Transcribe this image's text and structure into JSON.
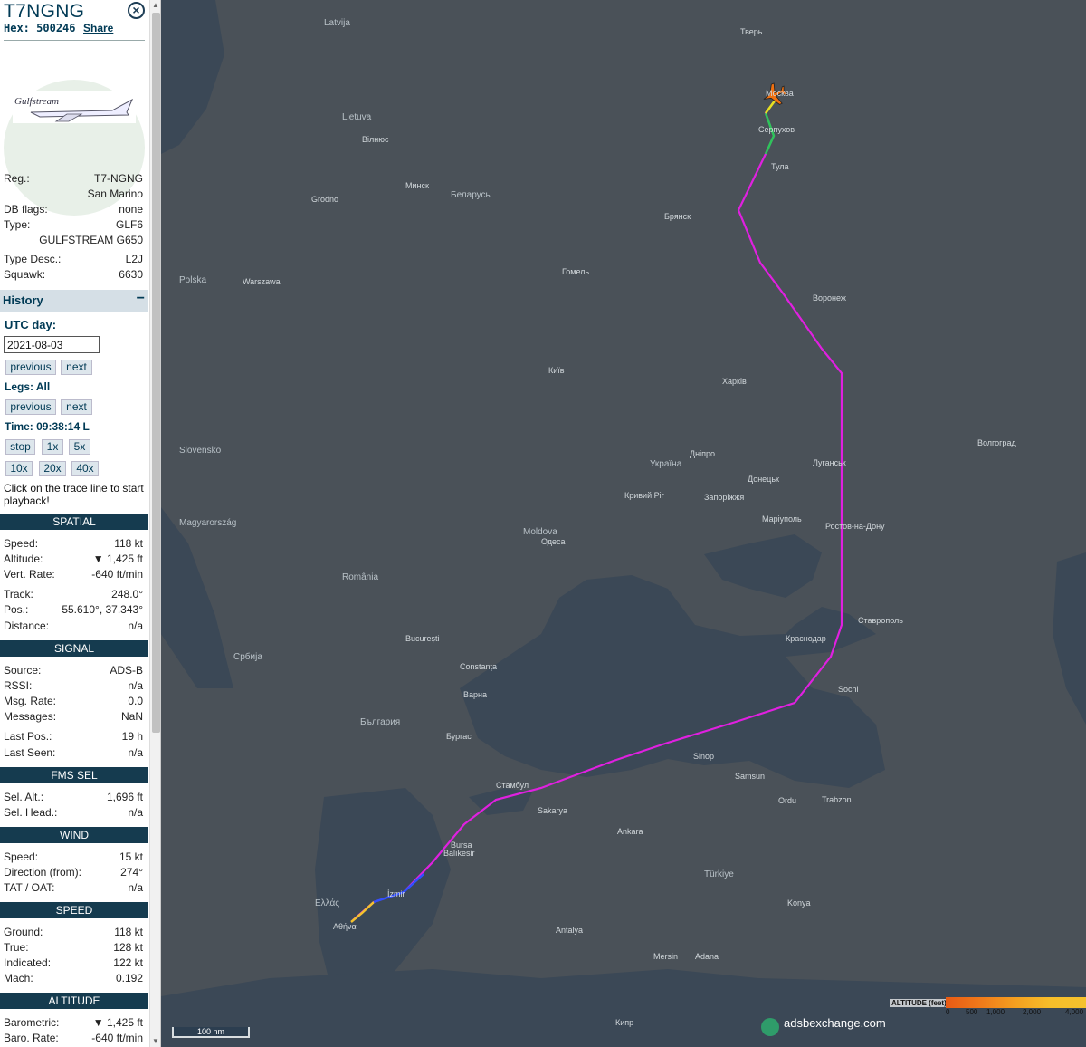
{
  "aircraft": {
    "callsign": "T7NGNG",
    "hex_label": "Hex:",
    "hex": "500246",
    "share_label": "Share",
    "logo_text": "Gulfstream"
  },
  "info": [
    {
      "k": "Reg.:",
      "v": "T7-NGNG"
    },
    {
      "k": "",
      "v": "San Marino"
    },
    {
      "k": "DB flags:",
      "v": "none"
    },
    {
      "k": "Type:",
      "v": "GLF6"
    },
    {
      "k": "",
      "v": "GULFSTREAM G650"
    },
    {
      "k": "Type Desc.:",
      "v": "L2J"
    },
    {
      "k": "Squawk:",
      "v": "6630"
    }
  ],
  "history": {
    "title": "History",
    "collapse": "−",
    "utc_label": "UTC day:",
    "date": "2021-08-03",
    "prev": "previous",
    "next": "next",
    "legs_label": "Legs: All",
    "time_label": "Time: 09:38:14 L",
    "stop": "stop",
    "s1x": "1x",
    "s5x": "5x",
    "s10x": "10x",
    "s20x": "20x",
    "s40x": "40x",
    "hint": "Click on the trace line to start playback!"
  },
  "spatial": {
    "title": "SPATIAL",
    "rows": [
      {
        "k": "Speed:",
        "v": "118 kt"
      },
      {
        "k": "Altitude:",
        "v": "▼ 1,425 ft"
      },
      {
        "k": "Vert. Rate:",
        "v": "-640 ft/min"
      },
      {
        "k": "Track:",
        "v": "248.0°"
      },
      {
        "k": "Pos.:",
        "v": "55.610°, 37.343°"
      },
      {
        "k": "Distance:",
        "v": "n/a"
      }
    ]
  },
  "signal": {
    "title": "SIGNAL",
    "rows": [
      {
        "k": "Source:",
        "v": "ADS-B"
      },
      {
        "k": "RSSI:",
        "v": "n/a"
      },
      {
        "k": "Msg. Rate:",
        "v": "0.0"
      },
      {
        "k": "Messages:",
        "v": "NaN"
      },
      {
        "k": "Last Pos.:",
        "v": "19 h"
      },
      {
        "k": "Last Seen:",
        "v": "n/a"
      }
    ]
  },
  "fms": {
    "title": "FMS SEL",
    "rows": [
      {
        "k": "Sel. Alt.:",
        "v": "1,696 ft"
      },
      {
        "k": "Sel. Head.:",
        "v": "n/a"
      }
    ]
  },
  "wind": {
    "title": "WIND",
    "rows": [
      {
        "k": "Speed:",
        "v": "15 kt"
      },
      {
        "k": "Direction (from):",
        "v": "274°"
      },
      {
        "k": "TAT / OAT:",
        "v": "n/a"
      }
    ]
  },
  "speed": {
    "title": "SPEED",
    "rows": [
      {
        "k": "Ground:",
        "v": "118 kt"
      },
      {
        "k": "True:",
        "v": "128 kt"
      },
      {
        "k": "Indicated:",
        "v": "122 kt"
      },
      {
        "k": "Mach:",
        "v": "0.192"
      }
    ]
  },
  "altitude": {
    "title": "ALTITUDE",
    "rows": [
      {
        "k": "Barometric:",
        "v": "▼ 1,425 ft"
      },
      {
        "k": "Baro. Rate:",
        "v": "-640 ft/min"
      }
    ]
  },
  "map": {
    "scale": "100 nm",
    "brand": "adsbexchange.com",
    "legend_title": "ALTITUDE (feet)",
    "legend_ticks": [
      "0",
      "500",
      "1,000",
      "2,000",
      "4,000"
    ],
    "colors": {
      "trace": "#e020e0",
      "land": "#50575e",
      "sea": "#3d4a58",
      "plane": "#f07010"
    },
    "countries": [
      "Latvija",
      "Lietuva",
      "Беларусь",
      "Polska",
      "Україна",
      "Moldova",
      "România",
      "България",
      "Türkiye",
      "Ελλάς",
      "Slovensko",
      "Magyarország",
      "Србија"
    ],
    "cities": [
      "Тверь",
      "Москва",
      "Серпухов",
      "Тула",
      "Брянск",
      "Гомель",
      "Минск",
      "Warszawa",
      "Київ",
      "Харків",
      "Воронеж",
      "Луганськ",
      "Ростов-на-Дону",
      "Одеса",
      "Constanța",
      "Варна",
      "București",
      "Бургас",
      "Стамбул",
      "Sakarya",
      "Ankara",
      "Bursa",
      "Balıkesir",
      "İzmir",
      "Αθήνα",
      "Вілнюс",
      "Grodno",
      "Краснодар",
      "Ставрополь",
      "Волгоград",
      "Sochi",
      "Trabzon",
      "Samsun",
      "Sinop",
      "Кривий Ріг",
      "Запоріжжя",
      "Маріуполь",
      "Донецьк",
      "Дніпро",
      "Ordu",
      "Konya",
      "Antalya",
      "Adana",
      "Mersin",
      "Кипр"
    ]
  }
}
